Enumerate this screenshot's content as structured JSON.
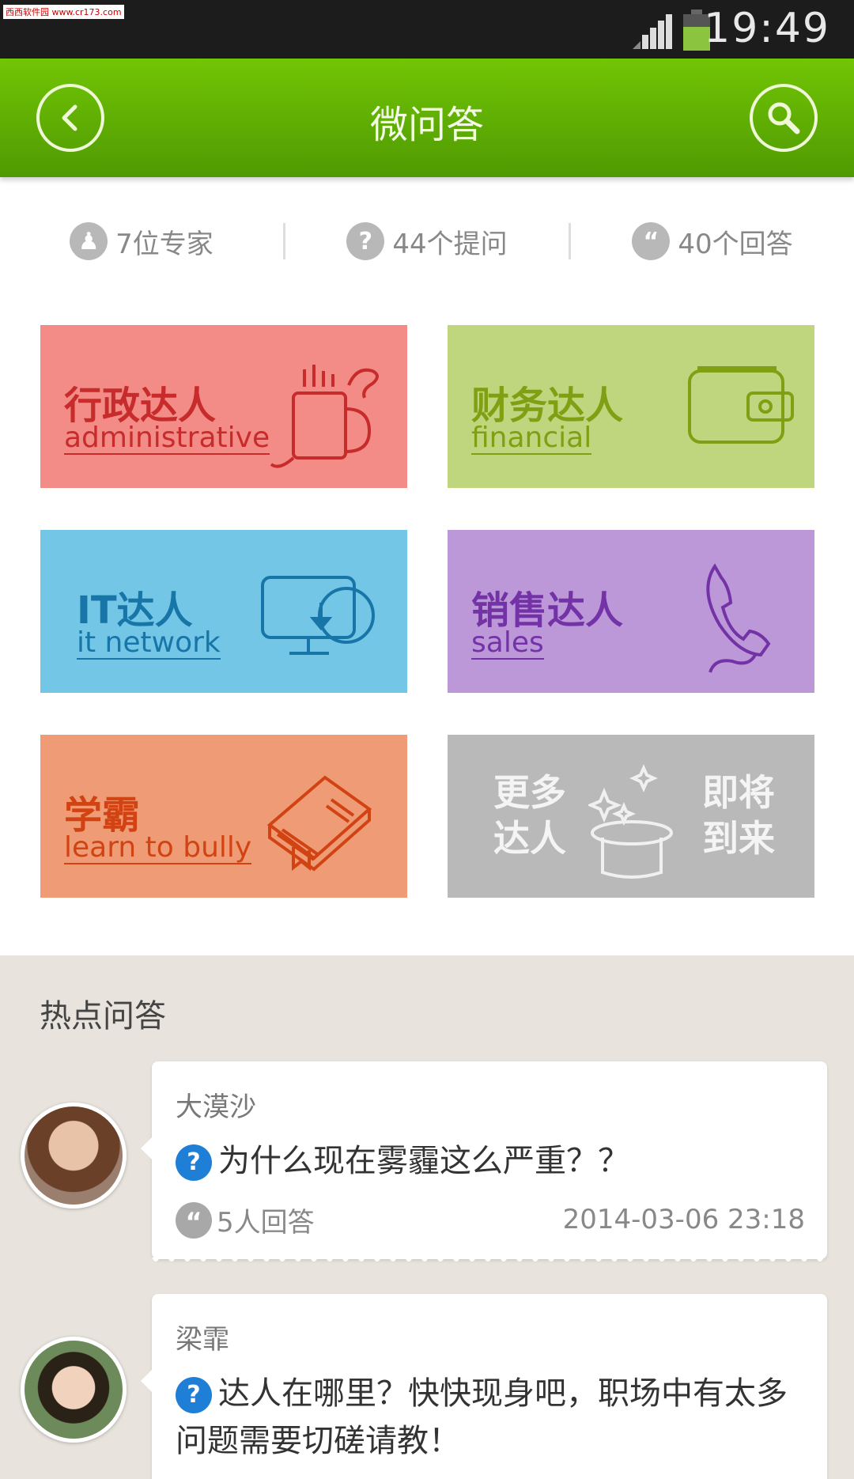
{
  "status_bar": {
    "watermark": "西西软件园 www.cr173.com",
    "time": "19:49"
  },
  "header": {
    "title": "微问答",
    "back_icon": "back-arrow-icon",
    "search_icon": "search-icon"
  },
  "stats": [
    {
      "icon": "person-icon",
      "glyph": "♟",
      "label": "7位专家"
    },
    {
      "icon": "question-icon",
      "glyph": "?",
      "label": "44个提问"
    },
    {
      "icon": "quote-icon",
      "glyph": "“",
      "label": "40个回答"
    }
  ],
  "categories": [
    {
      "title": "达人",
      "prefix": "行政",
      "subtitle": "administrative",
      "icon": "mug-icon",
      "color": "#f38b86"
    },
    {
      "title": "达人",
      "prefix": "财务",
      "subtitle": "financial",
      "icon": "wallet-icon",
      "color": "#bfd67e"
    },
    {
      "title": "达人",
      "prefix": "IT",
      "subtitle": "it network",
      "icon": "monitor-icon",
      "color": "#73c6e5"
    },
    {
      "title": "达人",
      "prefix": "销售",
      "subtitle": "sales",
      "icon": "phone-icon",
      "color": "#bd98d9"
    },
    {
      "title": "",
      "prefix": "学霸",
      "subtitle": "learn to bully",
      "icon": "book-icon",
      "color": "#ef9c76"
    }
  ],
  "tile_titles": {
    "admin": "行政达人",
    "fin": "财务达人",
    "it": "IT达人",
    "sales": "销售达人",
    "learn": "学霸"
  },
  "more_tile": {
    "left_line1": "更多",
    "left_line2": "达人",
    "right_line1": "即将",
    "right_line2": "到来",
    "icon": "magic-hat-icon"
  },
  "hot_section": {
    "title": "热点问答",
    "items": [
      {
        "user": "大漠沙",
        "question": "为什么现在雾霾这么严重？？",
        "answers": "5人回答",
        "time": "2014-03-06  23:18"
      },
      {
        "user": "梁霏",
        "question": "达人在哪里？快快现身吧，职场中有太多问题需要切磋请教！"
      }
    ]
  }
}
